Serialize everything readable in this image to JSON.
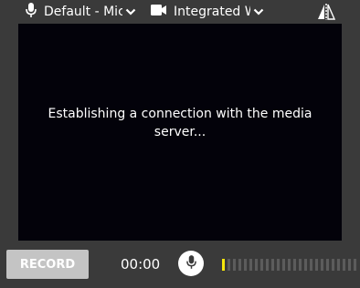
{
  "devices": {
    "microphone": {
      "selected": "Default - Microphone",
      "icon": "microphone-icon"
    },
    "camera": {
      "selected": "Integrated Webcam",
      "icon": "video-camera-icon"
    }
  },
  "video": {
    "status_line1": "Establishing a connection with the media",
    "status_line2": "server..."
  },
  "controls": {
    "record_label": "RECORD",
    "timer": "00:00",
    "mic_icon": "microphone-icon",
    "audio_level": 0.04,
    "audio_level_segments": 25
  },
  "colors": {
    "bar_background": "#3a3a3a",
    "video_background": "#03020a",
    "record_button": "#c4c4c4",
    "level_active": "#f5e60c",
    "level_inactive": "#5c5c5c"
  }
}
